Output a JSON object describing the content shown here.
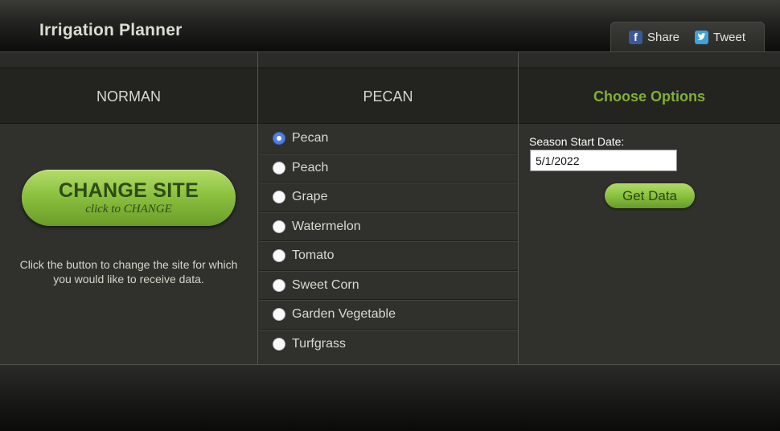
{
  "header": {
    "title": "Irrigation Planner"
  },
  "social": {
    "share_label": "Share",
    "tweet_label": "Tweet",
    "share_icon": "facebook-icon",
    "tweet_icon": "twitter-icon"
  },
  "columns": {
    "site": "NORMAN",
    "crop": "PECAN",
    "options": "Choose Options"
  },
  "site_panel": {
    "button_title": "CHANGE SITE",
    "button_sub": "click to CHANGE",
    "help_text": "Click the button to change the site for which you would like to receive data."
  },
  "crops": [
    {
      "label": "Pecan",
      "selected": true
    },
    {
      "label": "Peach",
      "selected": false
    },
    {
      "label": "Grape",
      "selected": false
    },
    {
      "label": "Watermelon",
      "selected": false
    },
    {
      "label": "Tomato",
      "selected": false
    },
    {
      "label": "Sweet Corn",
      "selected": false
    },
    {
      "label": "Garden Vegetable",
      "selected": false
    },
    {
      "label": "Turfgrass",
      "selected": false
    }
  ],
  "options": {
    "season_label": "Season Start Date:",
    "season_value": "5/1/2022",
    "get_data_label": "Get Data"
  },
  "colors": {
    "accent": "#8cc140",
    "options_heading": "#7fb037",
    "selected_radio": "#4f7fe3"
  }
}
